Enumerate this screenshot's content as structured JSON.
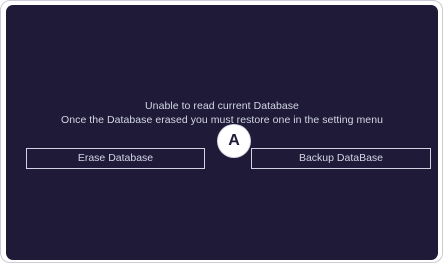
{
  "dialog": {
    "line1": "Unable to read current Database",
    "line2": "Once the Database erased you must restore one in the setting menu",
    "erase_button": "Erase Database",
    "backup_button": "Backup DataBase"
  },
  "marker": {
    "label": "A"
  },
  "colors": {
    "screen_background": "#1e1a38",
    "text": "#d3d6e6",
    "button_border": "#cfd3e2",
    "marker_background": "#ffffff"
  }
}
